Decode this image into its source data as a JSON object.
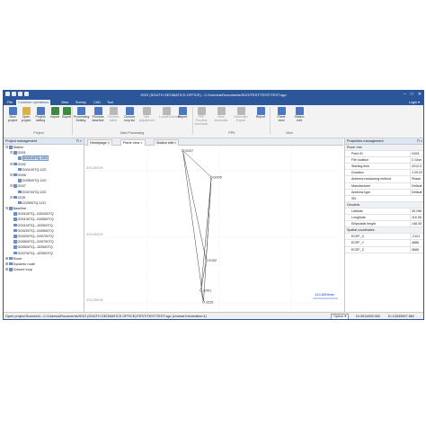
{
  "window": {
    "title": "SGO (SOUTH GEOMATICS OFFICE) - C:/Users/a/Documents/SGO/TEST/TEST/TEST.sgo",
    "controls": [
      "–",
      "□",
      "✕"
    ]
  },
  "menu": {
    "tabs": [
      "File",
      "Common operations",
      "View",
      "Survey",
      "CAD",
      "Tool"
    ],
    "active_index": 1,
    "login_label": "Login ▾"
  },
  "ribbon": {
    "buttons": [
      {
        "label": "New project",
        "icon": "new-project-icon",
        "color": "#4a78c2",
        "disabled": false
      },
      {
        "label": "Open project",
        "icon": "open-project-icon",
        "color": "#e0b040",
        "disabled": false
      },
      {
        "label": "Project setting",
        "icon": "project-setting-icon",
        "color": "#4a78c2",
        "disabled": false
      },
      {
        "label": "Import",
        "icon": "import-icon",
        "color": "#3d8b3d",
        "disabled": false
      },
      {
        "label": "Export",
        "icon": "export-icon",
        "color": "#3d8b3d",
        "disabled": false
      },
      {
        "label": "Processing Setting",
        "icon": "processing-setting-icon",
        "color": "#4a78c2",
        "disabled": false
      },
      {
        "label": "Process baseline",
        "icon": "process-baseline-icon",
        "color": "#4a78c2",
        "disabled": false
      },
      {
        "label": "Process failed",
        "icon": "process-failed-icon",
        "color": "#b8b8b8",
        "disabled": true
      },
      {
        "label": "Closure loop list",
        "icon": "closure-loop-icon",
        "color": "#4a78c2",
        "disabled": false
      },
      {
        "label": "Net adjustment",
        "icon": "net-adjustment-icon",
        "color": "#b8b8b8",
        "disabled": true
      },
      {
        "label": "Local/Kinematic",
        "icon": "local-kinematic-icon",
        "color": "#b8b8b8",
        "disabled": true
      },
      {
        "label": "Report",
        "icon": "report-icon",
        "color": "#4a78c2",
        "disabled": false
      },
      {
        "label": "PPK Process kinematic",
        "icon": "ppk-process-icon",
        "color": "#b8b8b8",
        "disabled": true
      },
      {
        "label": "View kinematic",
        "icon": "view-kinematic-icon",
        "color": "#b8b8b8",
        "disabled": true
      },
      {
        "label": "Kinematic Export",
        "icon": "kinematic-export-icon",
        "color": "#b8b8b8",
        "disabled": true
      },
      {
        "label": "Report",
        "icon": "ppk-report-icon",
        "color": "#4a78c2",
        "disabled": false
      },
      {
        "label": "Plane view",
        "icon": "plane-view-icon",
        "color": "#4a78c2",
        "disabled": false
      },
      {
        "label": "Station edit",
        "icon": "station-edit-icon",
        "color": "#4a78c2",
        "disabled": false
      }
    ],
    "groups": [
      "Project",
      "Data Processing",
      "PPK",
      "View"
    ]
  },
  "left_panel": {
    "title": "Project management",
    "pin": "⊓ ×",
    "tree": [
      {
        "label": "Station",
        "level": 0,
        "expander": "⊟",
        "selected": false
      },
      {
        "label": "G001",
        "level": 1,
        "expander": "⊟",
        "selected": false
      },
      {
        "label": "G00100TQ.12O",
        "level": 2,
        "expander": "",
        "selected": true
      },
      {
        "label": "G002",
        "level": 1,
        "expander": "⊟",
        "selected": false
      },
      {
        "label": "G00100TQ.12O",
        "level": 2,
        "expander": "",
        "selected": false
      },
      {
        "label": "G005",
        "level": 1,
        "expander": "⊟",
        "selected": false
      },
      {
        "label": "G00500TQ.12O",
        "level": 2,
        "expander": "",
        "selected": false
      },
      {
        "label": "G007",
        "level": 1,
        "expander": "⊟",
        "selected": false
      },
      {
        "label": "G00700TQ.12O",
        "level": 2,
        "expander": "",
        "selected": false
      },
      {
        "label": "JZ25",
        "level": 1,
        "expander": "⊟",
        "selected": false
      },
      {
        "label": "JZ2500TQ.12O",
        "level": 2,
        "expander": "",
        "selected": false
      },
      {
        "label": "Baseline",
        "level": 0,
        "expander": "⊟",
        "selected": false
      },
      {
        "label": "G00100TQ--G00200TQ",
        "level": 1,
        "expander": "",
        "selected": false
      },
      {
        "label": "G00100TQ--G00500TQ",
        "level": 1,
        "expander": "",
        "selected": false
      },
      {
        "label": "G00100TQ--JZ2500TQ",
        "level": 1,
        "expander": "",
        "selected": false
      },
      {
        "label": "G00200TQ--G00500TQ",
        "level": 1,
        "expander": "",
        "selected": false
      },
      {
        "label": "G00200TQ--G00700TQ",
        "level": 1,
        "expander": "",
        "selected": false
      },
      {
        "label": "G00500TQ--G00700TQ",
        "level": 1,
        "expander": "",
        "selected": false
      },
      {
        "label": "G00500TQ--JZ2500TQ",
        "level": 1,
        "expander": "",
        "selected": false
      },
      {
        "label": "G00700TQ--JZ2500TQ",
        "level": 1,
        "expander": "",
        "selected": false
      },
      {
        "label": "Rover",
        "level": 0,
        "expander": "⊞",
        "selected": false
      },
      {
        "label": "Dynamic route",
        "level": 0,
        "expander": "⊞",
        "selected": false
      },
      {
        "label": "Closure loop",
        "level": 0,
        "expander": "⊞",
        "selected": false
      }
    ]
  },
  "center": {
    "tabs": [
      "Homepage ×",
      "Plane view ×",
      "Station edit ×"
    ],
    "active_tab": 1,
    "y_ticks": [
      "3912650N",
      "3912600N",
      "3912550N"
    ],
    "scale_label": "143.80Meter",
    "stations": [
      {
        "name": "G007",
        "x": 0.38,
        "y": 0.97
      },
      {
        "name": "G005",
        "x": 0.49,
        "y": 0.81
      },
      {
        "name": "G002",
        "x": 0.47,
        "y": 0.31
      },
      {
        "name": "G001",
        "x": 0.45,
        "y": 0.13
      },
      {
        "name": "JZ25",
        "x": 0.46,
        "y": 0.06
      }
    ],
    "baselines": [
      [
        "G001",
        "G002"
      ],
      [
        "G001",
        "G005"
      ],
      [
        "G001",
        "JZ25"
      ],
      [
        "G002",
        "G005"
      ],
      [
        "G002",
        "G007"
      ],
      [
        "G005",
        "G007"
      ],
      [
        "G005",
        "JZ25"
      ],
      [
        "G007",
        "JZ25"
      ]
    ]
  },
  "right_panel": {
    "title": "Properties management",
    "pin": "⊓ ×",
    "sections": [
      {
        "name": "Rover Info",
        "rows": [
          {
            "key": "Point ID",
            "value": "G001"
          },
          {
            "key": "File location",
            "value": "C:\\Use"
          },
          {
            "key": "Starting time",
            "value": "2012-0"
          },
          {
            "key": "Duration",
            "value": "1:29:22"
          },
          {
            "key": "Antenna measuring method",
            "value": "Phase"
          },
          {
            "key": "Manufacturer",
            "value": "Default"
          },
          {
            "key": "Antenna type",
            "value": "Default"
          },
          {
            "key": "SN",
            "value": ""
          }
        ]
      },
      {
        "name": "Geodetic",
        "rows": [
          {
            "key": "Latitude",
            "value": "35.296"
          },
          {
            "key": "Longitude",
            "value": "116.28"
          },
          {
            "key": "Ellipsoidal height",
            "value": "148.30"
          }
        ]
      },
      {
        "name": "Spatial coordinates",
        "rows": [
          {
            "key": "ECEF_X",
            "value": "-2101"
          },
          {
            "key": "ECEF_Y",
            "value": "4686"
          },
          {
            "key": "ECEF_Z",
            "value": "3665"
          }
        ]
      }
    ]
  },
  "status": {
    "message": "Open project:Succeed!---C:/Users/a/Documents/SGO (SOUTH GEOMATICS OFFICE)/TEST/TEST/TEST.sgo (Unread Information:4)",
    "options_label": "Option ▾",
    "coord_n": "N=3911005.950",
    "coord_e": "E=12639057.862"
  },
  "colors": {
    "brand": "#2b579a",
    "selection": "#cfe2fb",
    "baseline": "#444444",
    "scale": "#1f4fd0"
  }
}
